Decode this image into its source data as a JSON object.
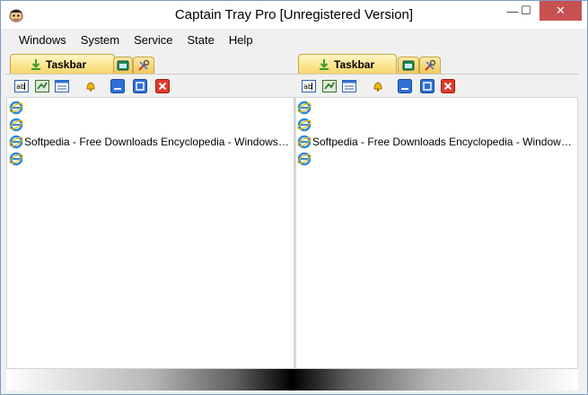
{
  "window": {
    "title": "Captain Tray Pro  [Unregistered Version]",
    "controls": {
      "minimize": "—",
      "maximize": "☐",
      "close": "✕"
    }
  },
  "menu": [
    "Windows",
    "System",
    "Service",
    "State",
    "Help"
  ],
  "panes": [
    {
      "tab_active_label": "Taskbar",
      "rows": [
        "",
        "",
        "Softpedia - Free Downloads Encyclopedia - Windows I...",
        ""
      ]
    },
    {
      "tab_active_label": "Taskbar",
      "rows": [
        "",
        "",
        "Softpedia - Free Downloads Encyclopedia - Windows ...",
        ""
      ]
    }
  ],
  "colors": {
    "accent_tab": "#f7d66a",
    "close_button": "#c75050",
    "toolbar_red": "#e03a2a",
    "toolbar_blue": "#2f6fd6"
  },
  "icons": {
    "app": "captain-face-icon",
    "toolbar": [
      "label-ab-icon",
      "chart-up-icon",
      "list-window-icon",
      "bell-icon",
      "minimize-window-icon",
      "maximize-window-icon",
      "close-x-icon"
    ],
    "rows": "internet-explorer-icon"
  }
}
